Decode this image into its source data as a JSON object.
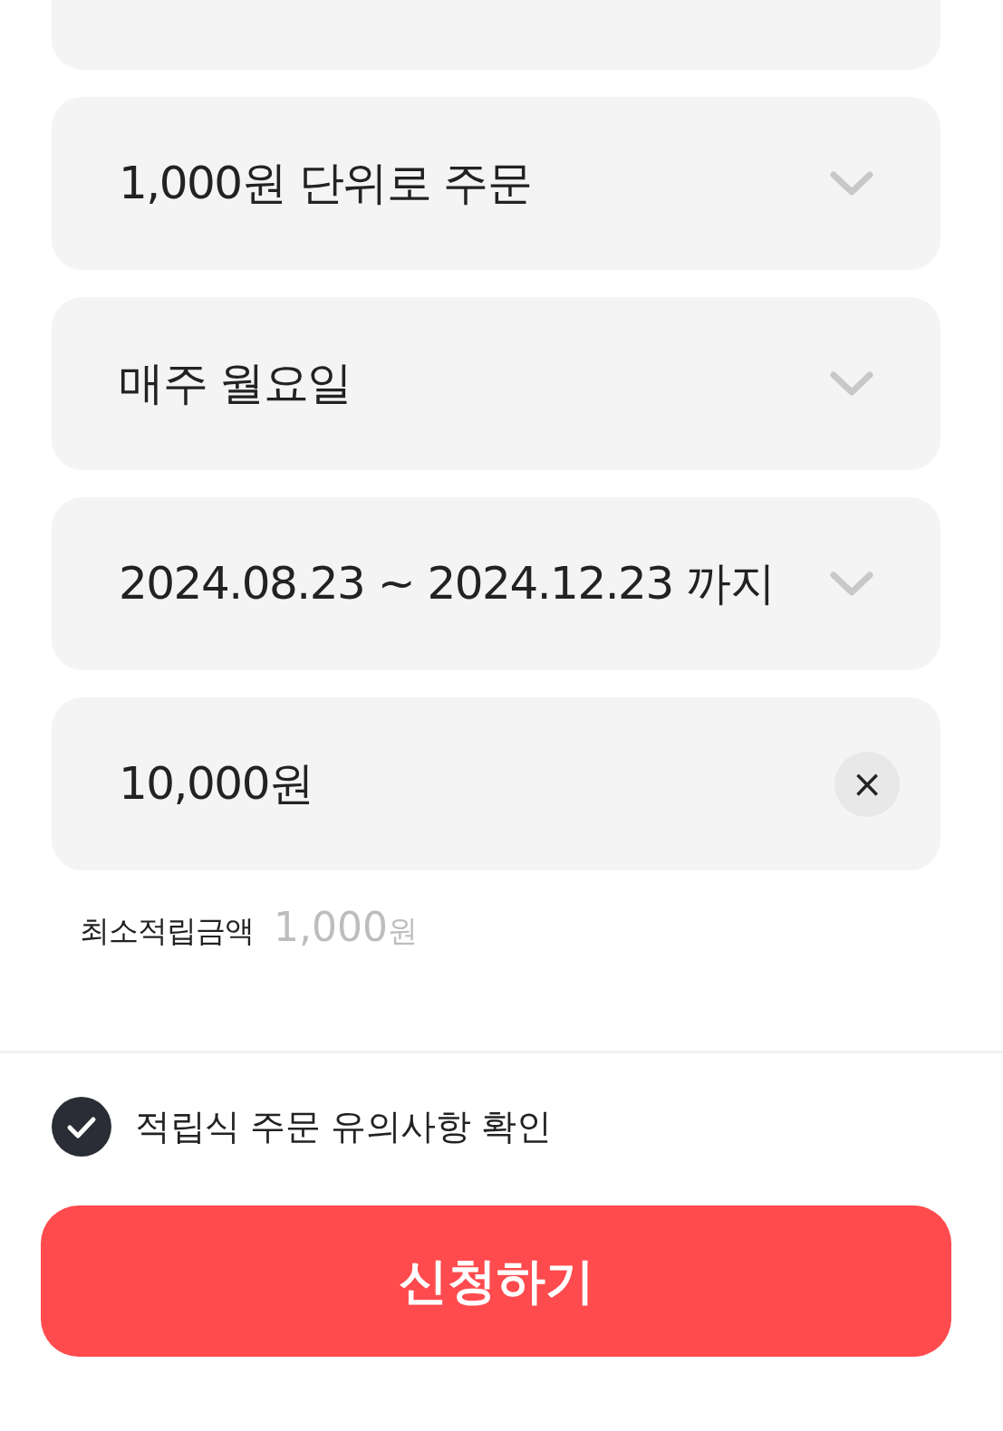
{
  "fields": [
    {
      "kind": "partial"
    },
    {
      "kind": "select",
      "value": "1,000원 단위로 주문"
    },
    {
      "kind": "select",
      "value": "매주 월요일"
    },
    {
      "kind": "select",
      "value": "2024.08.23 ~ 2024.12.23 까지"
    },
    {
      "kind": "input",
      "value": "10,000원",
      "clear_button": "×"
    }
  ],
  "minimum": {
    "label": "최소적립금액",
    "amount": "1,000",
    "unit": "원"
  },
  "agreement": {
    "label": "적립식 주문 유의사항 확인",
    "checked": true
  },
  "submit_button": "신청하기"
}
